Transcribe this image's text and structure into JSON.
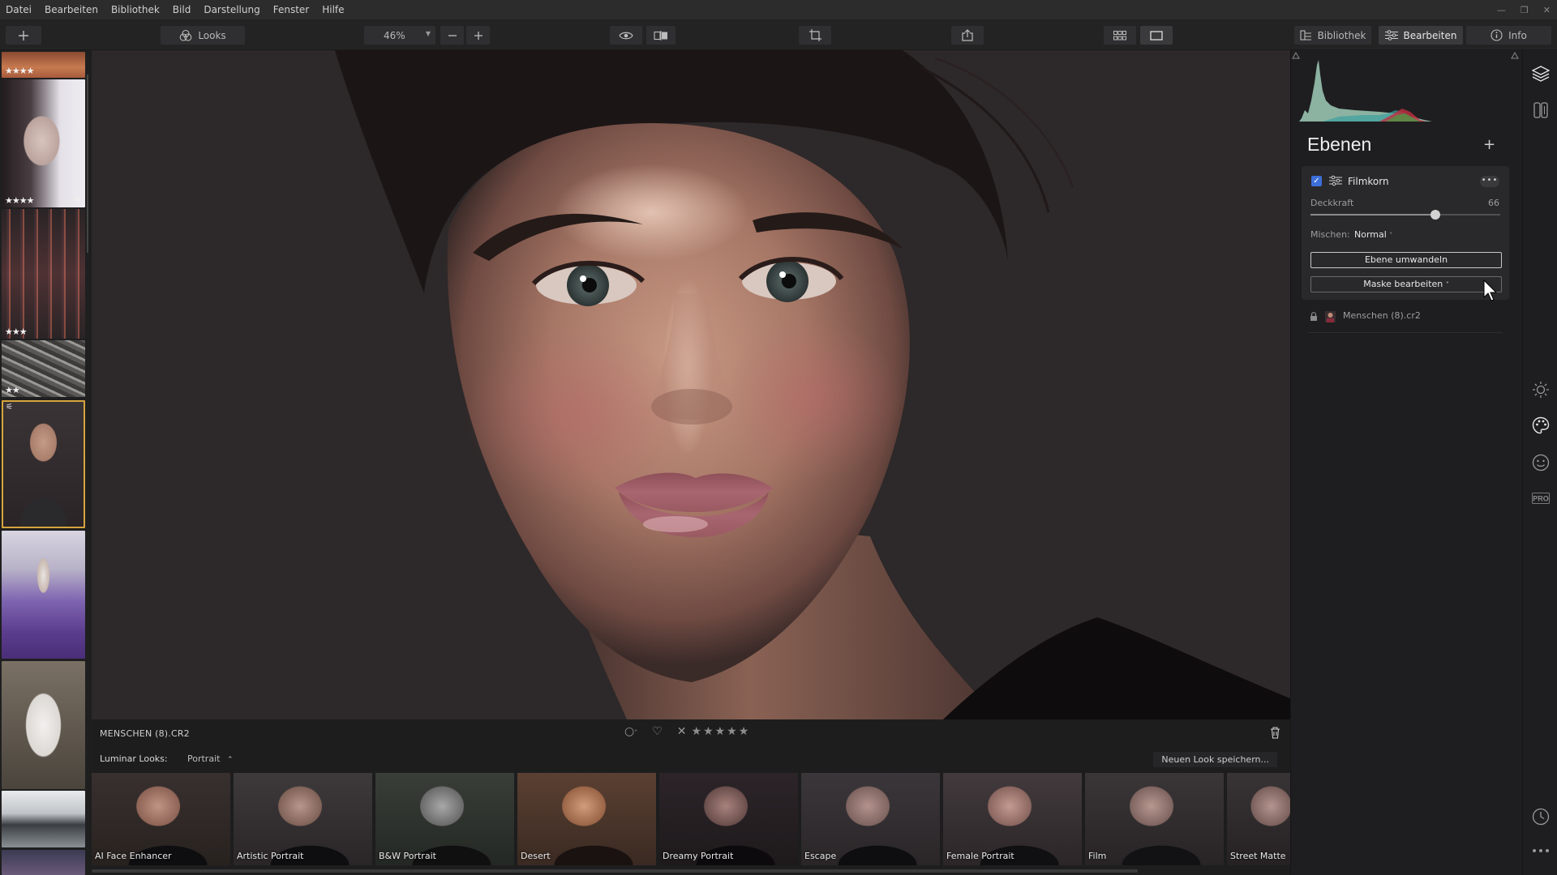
{
  "menu": [
    "Datei",
    "Bearbeiten",
    "Bibliothek",
    "Bild",
    "Darstellung",
    "Fenster",
    "Hilfe"
  ],
  "toolbar": {
    "looks_label": "Looks",
    "zoom": "46%",
    "tabs": [
      {
        "label": "Bibliothek",
        "icon": "library-icon"
      },
      {
        "label": "Bearbeiten",
        "icon": "sliders-icon",
        "active": true
      },
      {
        "label": "Info",
        "icon": "info-icon"
      }
    ]
  },
  "filmstrip": {
    "thumbs": [
      {
        "stars": "★★★★"
      },
      {
        "stars": "★★★★",
        "heart": "♥"
      },
      {
        "stars": "★★★"
      },
      {
        "stars": "★★"
      },
      {
        "stars": "",
        "selected": true
      },
      {
        "stars": ""
      },
      {
        "stars": ""
      },
      {
        "stars": ""
      }
    ]
  },
  "info_strip": {
    "filename": "MENSCHEN (8).CR2",
    "stars": "★★★★★"
  },
  "looks_bar": {
    "label": "Luminar Looks:",
    "category": "Portrait",
    "save_label": "Neuen Look speichern...",
    "looks": [
      "AI Face Enhancer",
      "Artistic Portrait",
      "B&W Portrait",
      "Desert",
      "Dreamy Portrait",
      "Escape",
      "Female Portrait",
      "Film",
      "Street Matte"
    ]
  },
  "layers": {
    "title": "Ebenen",
    "card": {
      "name": "Filmkorn",
      "opacity_label": "Deckkraft",
      "opacity_value": 66,
      "mix_label": "Mischen:",
      "mix_value": "Normal",
      "convert_label": "Ebene umwandeln",
      "mask_label": "Maske bearbeiten"
    },
    "base_layer": "Menschen (8).cr2"
  },
  "colors": {
    "accent": "#3d6fd8",
    "selection": "#d6a53d"
  }
}
